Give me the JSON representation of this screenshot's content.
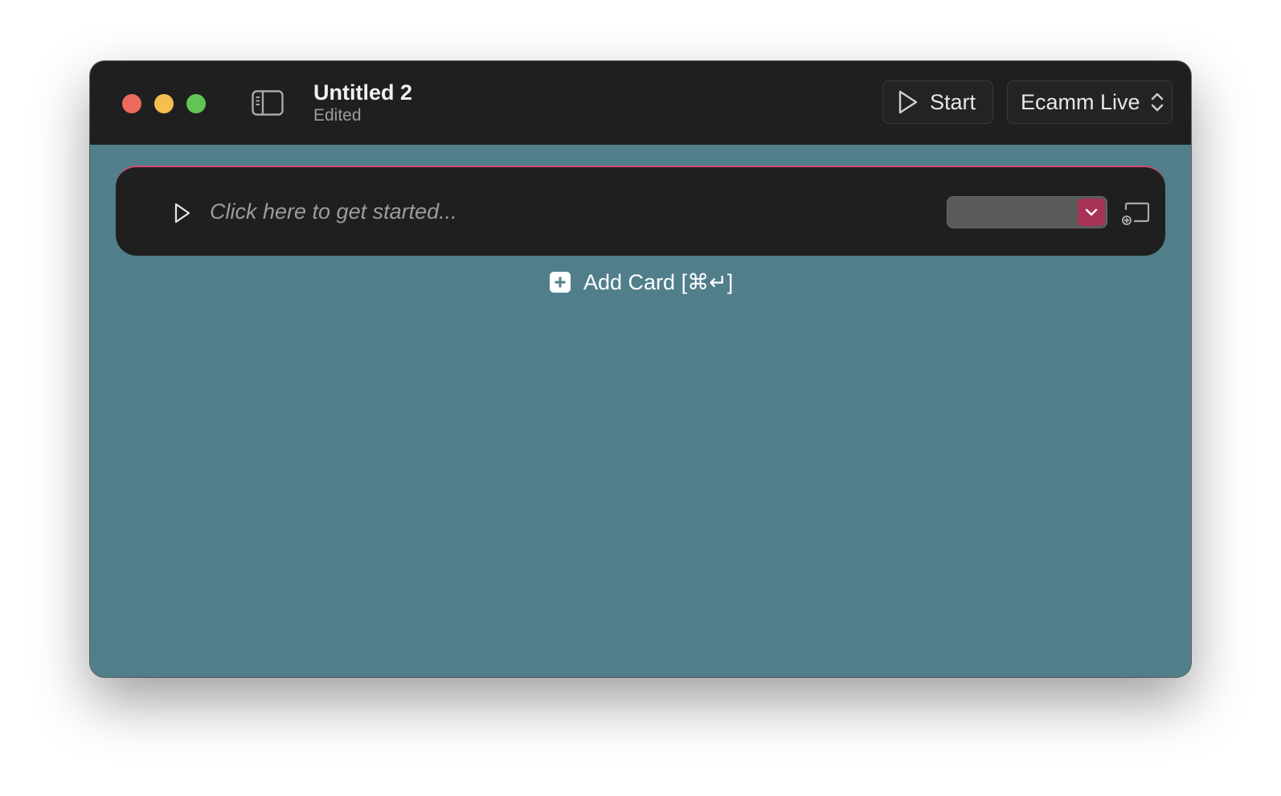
{
  "window": {
    "title": "Untitled 2",
    "subtitle": "Edited"
  },
  "toolbar": {
    "start_label": "Start",
    "output_select_value": "Ecamm Live"
  },
  "card": {
    "placeholder": "Click here to get started...",
    "select_value": ""
  },
  "add_card": {
    "label": "Add Card [⌘↵]"
  },
  "colors": {
    "content_bg": "#507f8b",
    "titlebar_bg": "#1f1f1f",
    "card_accent": "#d2487a",
    "select_arrow": "#a63356",
    "traffic_red": "#ed6a5e",
    "traffic_yellow": "#f5bf4f",
    "traffic_green": "#61c554"
  },
  "icons": {
    "sidebar_toggle": "sidebar-icon",
    "start": "play-icon",
    "output_select": "chevron-up-down-icon",
    "card_play": "play-icon",
    "card_select": "chevron-down-icon",
    "cast": "cast-icon",
    "add_card": "plus-square-icon"
  }
}
